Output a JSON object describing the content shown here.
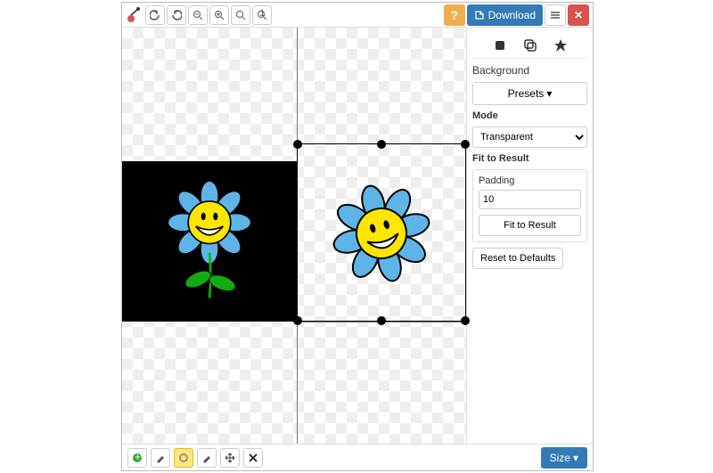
{
  "toolbar": {
    "download": "Download"
  },
  "sidebar": {
    "section": "Background",
    "presets": "Presets",
    "mode_label": "Mode",
    "mode_value": "Transparent",
    "fit_section": "Fit to Result",
    "padding_label": "Padding",
    "padding_value": "10",
    "fit_button": "Fit to Result",
    "reset": "Reset to Defaults"
  },
  "bottombar": {
    "size": "Size"
  },
  "caret": "▾"
}
